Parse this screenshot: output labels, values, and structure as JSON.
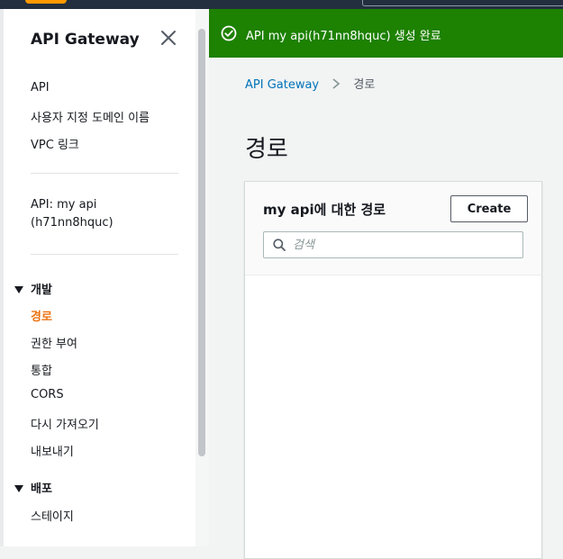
{
  "sidebar": {
    "title": "API Gateway",
    "top_links": [
      "API",
      "사용자 지정 도메인 이름",
      "VPC 링크"
    ],
    "api_label_line1": "API: my api",
    "api_label_line2": "(h71nn8hquc)",
    "sections": [
      {
        "title": "개발",
        "items": [
          "경로",
          "권한 부여",
          "통합",
          "CORS",
          "다시 가져오기",
          "내보내기"
        ],
        "active_index": 0
      },
      {
        "title": "배포",
        "items": [
          "스테이지"
        ]
      }
    ]
  },
  "flash": {
    "message": "API my api(h71nn8hquc) 생성 완료",
    "icon": "check-circle-icon",
    "color": "#1d8102"
  },
  "breadcrumb": {
    "root": "API Gateway",
    "current": "경로"
  },
  "page": {
    "title": "경로"
  },
  "routes_panel": {
    "title": "my api에 대한 경로",
    "create_label": "Create",
    "search_placeholder": "검색",
    "search_value": ""
  },
  "colors": {
    "active": "#ec7211",
    "link": "#0073bb",
    "topbar": "#232f3e"
  }
}
